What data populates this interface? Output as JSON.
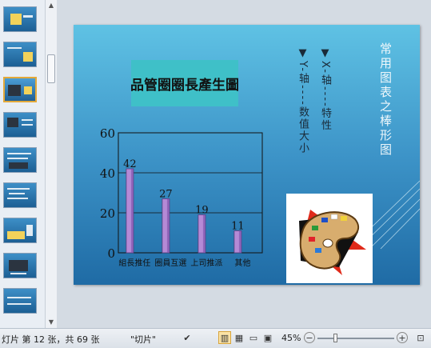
{
  "slide": {
    "title": "品管圈圈長產生圖",
    "vertical_title": "常用图表之棒形图",
    "x_axis_note": "▼X-轴----特性",
    "y_axis_note": "▼Y-轴----数值大小"
  },
  "chart_data": {
    "type": "bar",
    "categories": [
      "組長推任",
      "圈員互選",
      "上司推派",
      "其他"
    ],
    "values": [
      42,
      27,
      19,
      11
    ],
    "title": "",
    "xlabel": "",
    "ylabel": "",
    "ylim": [
      0,
      60
    ],
    "y_ticks": [
      "0",
      "20",
      "40",
      "60"
    ],
    "bar_color": "#b58ad6",
    "grid": true
  },
  "statusbar": {
    "slide_info": "灯片 第 12 张，共 69 张",
    "theme": "\"切片\"",
    "zoom": "45%"
  },
  "icons": {
    "spell_check": "spell-check-icon",
    "view_normal": "normal-view-icon",
    "view_sorter": "slide-sorter-icon",
    "view_reading": "reading-view-icon",
    "view_show": "slideshow-icon",
    "zoom_out": "minus",
    "zoom_in": "plus",
    "fit": "fit-to-window-icon"
  }
}
